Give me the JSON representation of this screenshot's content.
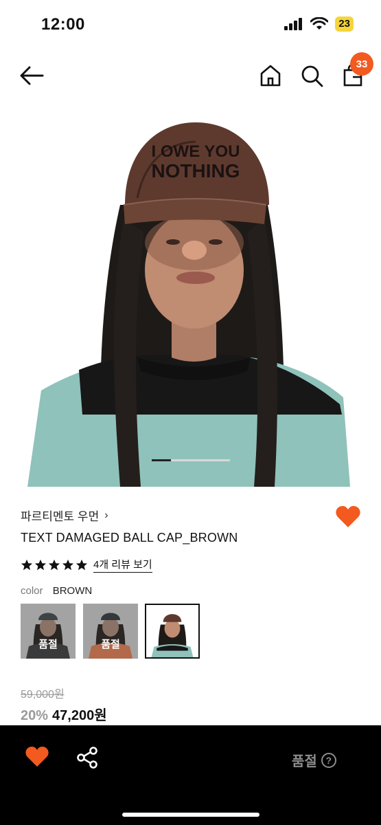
{
  "status_bar": {
    "time": "12:00",
    "battery": "23"
  },
  "nav": {
    "cart_count": "33"
  },
  "product": {
    "brand": "파르티멘토 우먼",
    "title": "TEXT DAMAGED BALL CAP_BROWN",
    "rating": {
      "stars": 5,
      "review_link": "4개 리뷰 보기"
    },
    "color_label": "color",
    "color_value": "BROWN",
    "hat_text": [
      "I OWE YOU",
      "NOTHING"
    ],
    "swatches": [
      {
        "soldout_label": "품절",
        "selected": false
      },
      {
        "soldout_label": "품절",
        "selected": false
      },
      {
        "soldout_label": "",
        "selected": true
      }
    ],
    "price_original": "59,000원",
    "discount": "20%",
    "price_final": "47,200원"
  },
  "bottom_bar": {
    "status": "품절",
    "help": "?"
  },
  "colors": {
    "accent": "#f25a1f",
    "heart": "#f25a1f",
    "bottom_bar": "#000000"
  },
  "icons": [
    "back-arrow-icon",
    "home-icon",
    "search-icon",
    "bag-icon",
    "heart-icon",
    "share-icon",
    "help-icon",
    "star-icon",
    "signal-icon",
    "wifi-icon"
  ]
}
